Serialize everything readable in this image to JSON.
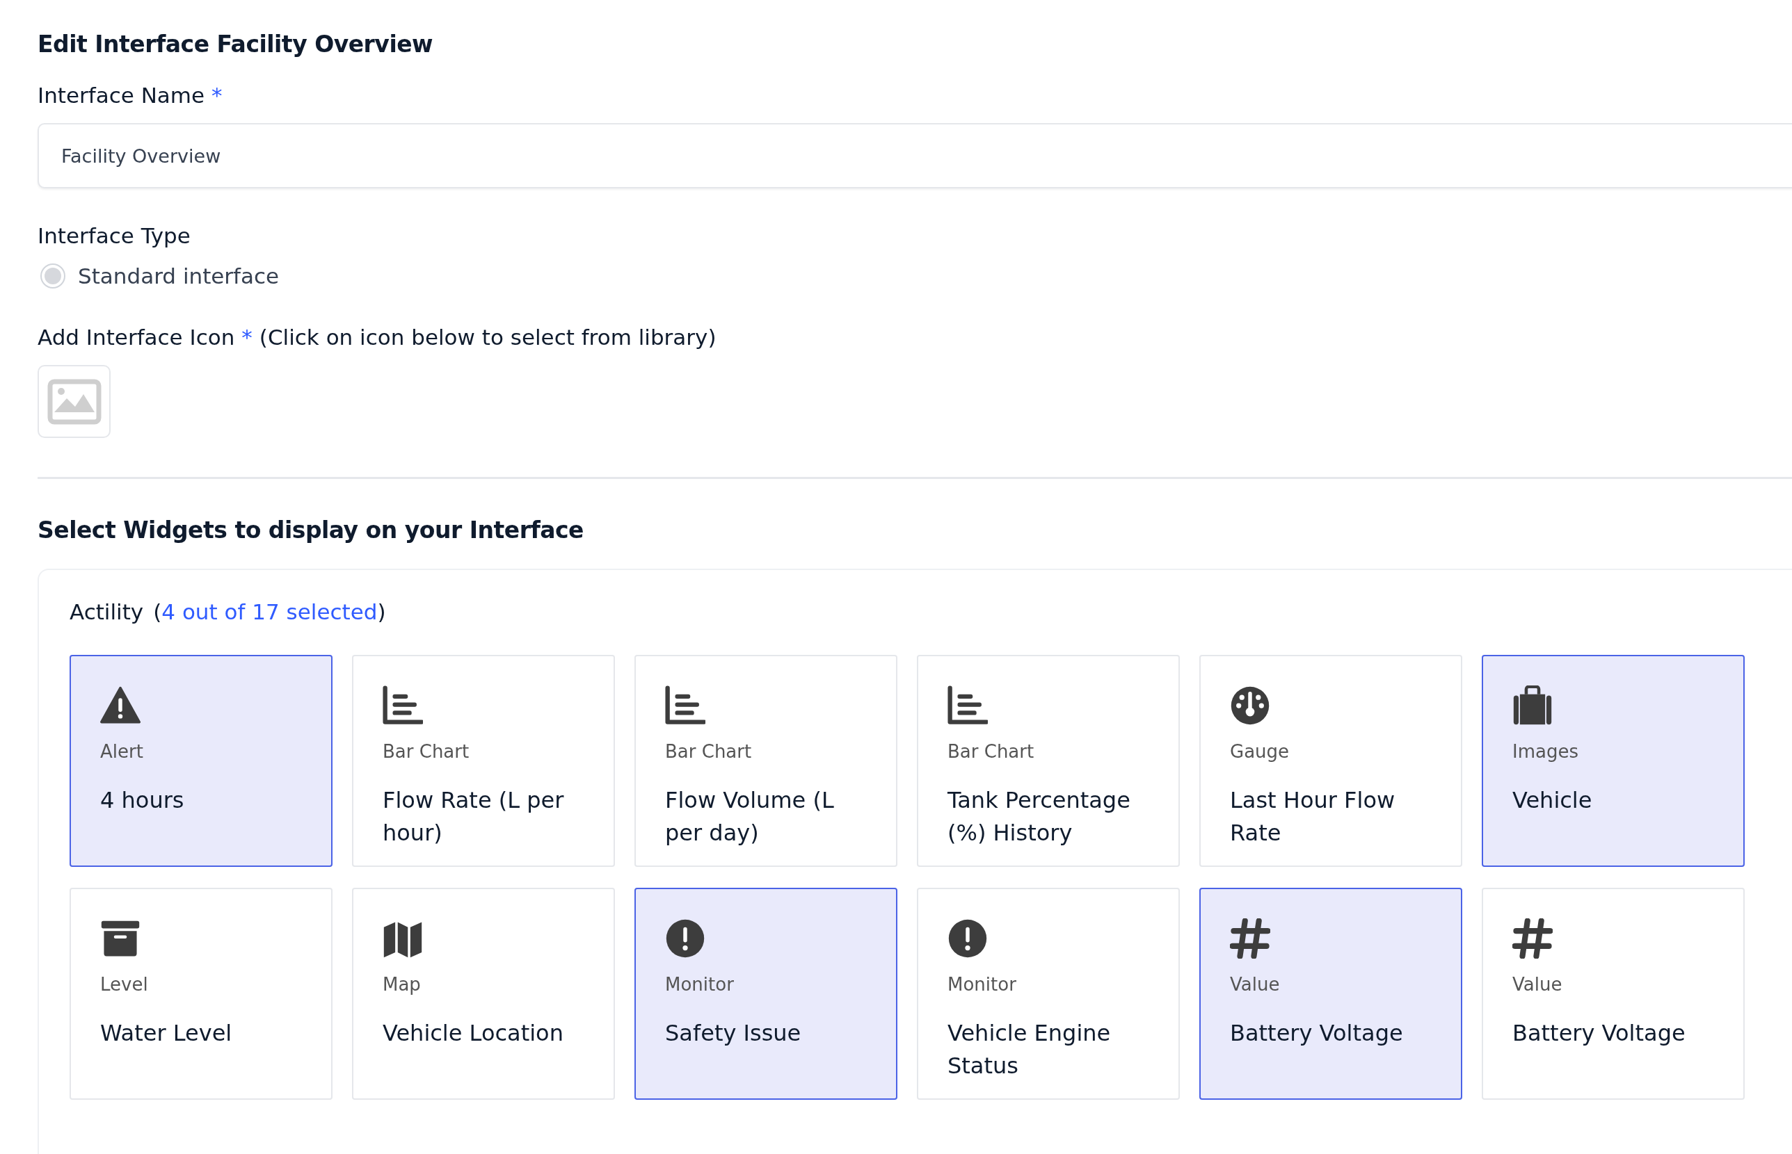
{
  "title": "Edit Interface Facility Overview",
  "name_field": {
    "label": "Interface Name",
    "required_mark": "*",
    "value": "Facility Overview"
  },
  "type_field": {
    "label": "Interface Type",
    "options": [
      {
        "label": "Standard interface",
        "selected": false
      }
    ]
  },
  "icon_field": {
    "label": "Add Interface Icon",
    "required_mark": "*",
    "hint": "(Click on icon below to select from library)"
  },
  "widgets_section": {
    "title": "Select Widgets to display on your Interface",
    "group": {
      "name": "Actility",
      "count_open": "(",
      "count": "4 out of 17 selected",
      "count_close": ")",
      "widgets": [
        {
          "kind": "alert",
          "type": "Alert",
          "name": "4 hours",
          "selected": true
        },
        {
          "kind": "bar",
          "type": "Bar Chart",
          "name": "Flow Rate (L per hour)",
          "selected": false
        },
        {
          "kind": "bar",
          "type": "Bar Chart",
          "name": "Flow Volume (L per day)",
          "selected": false
        },
        {
          "kind": "bar",
          "type": "Bar Chart",
          "name": "Tank Percentage (%) History",
          "selected": false
        },
        {
          "kind": "gauge",
          "type": "Gauge",
          "name": "Last Hour Flow Rate",
          "selected": false
        },
        {
          "kind": "images",
          "type": "Images",
          "name": "Vehicle",
          "selected": true
        },
        {
          "kind": "level",
          "type": "Level",
          "name": "Water Level",
          "selected": false
        },
        {
          "kind": "map",
          "type": "Map",
          "name": "Vehicle Location",
          "selected": false
        },
        {
          "kind": "monitor",
          "type": "Monitor",
          "name": "Safety Issue",
          "selected": true
        },
        {
          "kind": "monitor",
          "type": "Monitor",
          "name": "Vehicle Engine Status",
          "selected": false
        },
        {
          "kind": "value",
          "type": "Value",
          "name": "Battery Voltage",
          "selected": true
        },
        {
          "kind": "value",
          "type": "Value",
          "name": "Battery Voltage",
          "selected": false
        }
      ]
    }
  }
}
